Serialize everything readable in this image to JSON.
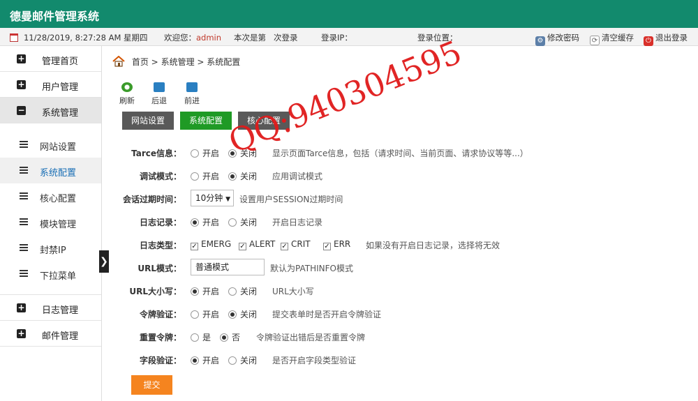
{
  "app": {
    "title": "德曼邮件管理系统"
  },
  "infobar": {
    "datetime": "11/28/2019, 8:27:28 AM 星期四",
    "welcome_prefix": "欢迎您：",
    "username": "admin",
    "login_count_prefix": "本次是第",
    "login_count_suffix": "次登录",
    "login_ip_label": "登录IP：",
    "login_location_label": "登录位置：",
    "change_password": "修改密码",
    "clear_cache": "清空缓存",
    "logout": "退出登录"
  },
  "sidebar": {
    "groups": [
      {
        "label": "管理首页",
        "icon": "plus-icon"
      },
      {
        "label": "用户管理",
        "icon": "plus-icon"
      },
      {
        "label": "系统管理",
        "icon": "minus-icon"
      }
    ],
    "subitems": [
      {
        "label": "网站设置"
      },
      {
        "label": "系统配置"
      },
      {
        "label": "核心配置"
      },
      {
        "label": "模块管理"
      },
      {
        "label": "封禁IP"
      },
      {
        "label": "下拉菜单"
      }
    ],
    "groups_bottom": [
      {
        "label": "日志管理",
        "icon": "plus-icon"
      },
      {
        "label": "邮件管理",
        "icon": "plus-icon"
      }
    ],
    "collapse_glyph": "❯"
  },
  "breadcrumb": {
    "home": "首页",
    "sep": ">",
    "level1": "系统管理",
    "level2": "系统配置"
  },
  "toolbar": {
    "refresh": "刷新",
    "back": "后退",
    "forward": "前进"
  },
  "tabs": [
    {
      "label": "网站设置"
    },
    {
      "label": "系统配置"
    },
    {
      "label": "核心配置"
    }
  ],
  "form": {
    "tarce": {
      "label": "Tarce信息：",
      "on": "开启",
      "off": "关闭",
      "hint": "显示页面Tarce信息，包括（请求时间、当前页面、请求协议等等...）"
    },
    "debug": {
      "label": "调试模式：",
      "on": "开启",
      "off": "关闭",
      "hint": "应用调试模式"
    },
    "session": {
      "label": "会话过期时间：",
      "value": "10分钟",
      "arrow": "▼",
      "hint": "设置用户SESSION过期时间"
    },
    "log": {
      "label": "日志记录：",
      "on": "开启",
      "off": "关闭",
      "hint": "开启日志记录"
    },
    "logtype": {
      "label": "日志类型：",
      "opts": [
        "EMERG",
        "ALERT",
        "CRIT",
        "ERR"
      ],
      "hint": "如果没有开启日志记录，选择将无效"
    },
    "urlmode": {
      "label": "URL模式：",
      "value": "普通模式",
      "hint": "默认为PATHINFO模式"
    },
    "urlcase": {
      "label": "URL大小写：",
      "on": "开启",
      "off": "关闭",
      "hint": "URL大小写"
    },
    "token": {
      "label": "令牌验证：",
      "on": "开启",
      "off": "关闭",
      "hint": "提交表单时是否开启令牌验证"
    },
    "resettoken": {
      "label": "重置令牌：",
      "yes": "是",
      "no": "否",
      "hint": "令牌验证出错后是否重置令牌"
    },
    "fieldcheck": {
      "label": "字段验证：",
      "on": "开启",
      "off": "关闭",
      "hint": "是否开启字段类型验证"
    },
    "submit": "提交"
  },
  "watermark": "QQ:940304595",
  "colors": {
    "topbar": "#128a6d",
    "active_tab": "#1f9a25",
    "tab": "#595959",
    "submit": "#f5841f",
    "watermark": "#e01a1a"
  }
}
